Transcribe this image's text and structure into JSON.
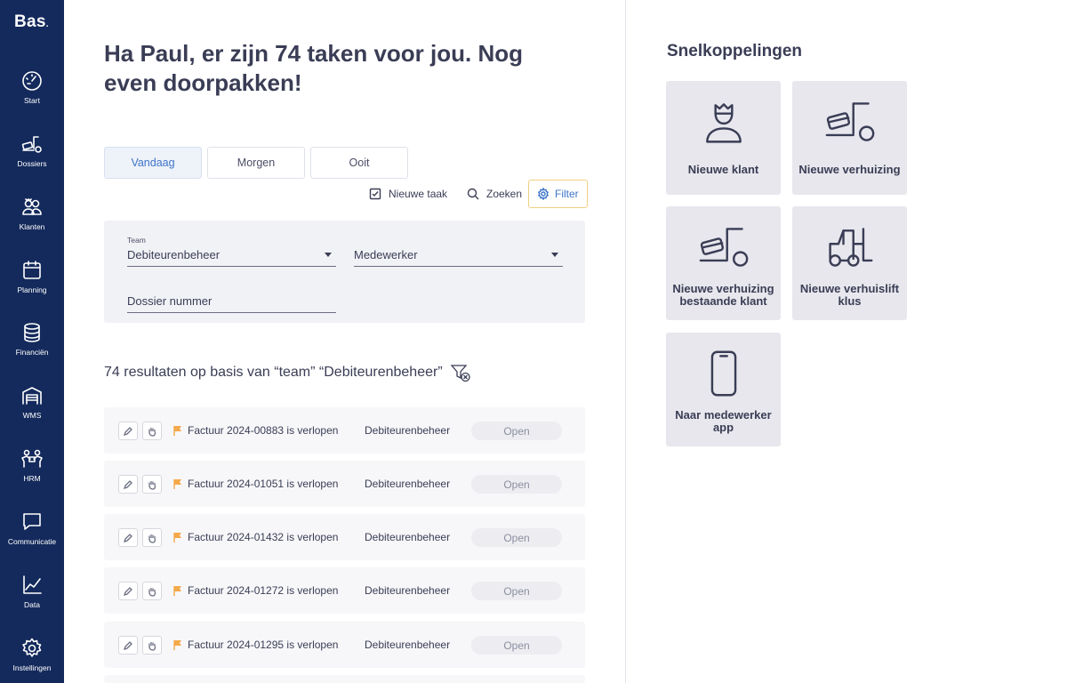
{
  "app": {
    "logo": "Bas",
    "logo_dot": "."
  },
  "sidebar": {
    "items": [
      {
        "label": "Start",
        "icon": "speedometer-icon"
      },
      {
        "label": "Dossiers",
        "icon": "moving-truck-icon"
      },
      {
        "label": "Klanten",
        "icon": "customers-icon"
      },
      {
        "label": "Planning",
        "icon": "calendar-icon"
      },
      {
        "label": "Financiën",
        "icon": "coins-icon"
      },
      {
        "label": "WMS",
        "icon": "warehouse-icon"
      },
      {
        "label": "HRM",
        "icon": "people-icon"
      },
      {
        "label": "Communicatie",
        "icon": "chat-icon"
      },
      {
        "label": "Data",
        "icon": "line-chart-icon"
      },
      {
        "label": "Instellingen",
        "icon": "gear-icon"
      }
    ]
  },
  "main": {
    "greeting": "Ha Paul, er zijn 74 taken voor jou. Nog even doorpakken!",
    "tabs": [
      {
        "label": "Vandaag",
        "active": true
      },
      {
        "label": "Morgen",
        "active": false
      },
      {
        "label": "Ooit",
        "active": false
      }
    ],
    "actions": {
      "new_task": "Nieuwe taak",
      "search": "Zoeken",
      "filter": "Filter"
    },
    "filters": {
      "team_label": "Team",
      "team_value": "Debiteurenbeheer",
      "employee_value": "Medewerker",
      "dossier_value": "Dossier nummer"
    },
    "results_text": "74 resultaten op basis van “team” “Debiteurenbeheer”",
    "tasks": [
      {
        "title": "Factuur 2024-00883 is verlopen",
        "team": "Debiteurenbeheer",
        "status": "Open"
      },
      {
        "title": "Factuur 2024-01051 is verlopen",
        "team": "Debiteurenbeheer",
        "status": "Open"
      },
      {
        "title": "Factuur 2024-01432 is verlopen",
        "team": "Debiteurenbeheer",
        "status": "Open"
      },
      {
        "title": "Factuur 2024-01272 is verlopen",
        "team": "Debiteurenbeheer",
        "status": "Open"
      },
      {
        "title": "Factuur 2024-01295 is verlopen",
        "team": "Debiteurenbeheer",
        "status": "Open"
      }
    ]
  },
  "shortcuts": {
    "title": "Snelkoppelingen",
    "tiles": [
      {
        "label_1": "Nieuwe klant",
        "label_2": "",
        "icon": "person-icon"
      },
      {
        "label_1": "Nieuwe verhuizing",
        "label_2": "",
        "icon": "moving-truck-icon"
      },
      {
        "label_1": "Nieuwe verhuizing",
        "label_2": "bestaande klant",
        "icon": "moving-truck-icon"
      },
      {
        "label_1": "Nieuwe verhuislift",
        "label_2": "klus",
        "icon": "forklift-icon"
      },
      {
        "label_1": "Naar medewerker",
        "label_2": "app",
        "icon": "smartphone-icon"
      }
    ]
  },
  "colors": {
    "sidebar": "#142a5c",
    "accent": "#3d74c9",
    "flag": "#f4a94a",
    "filter_border": "#f2cf83",
    "tile_bg": "#e7e7ed"
  }
}
